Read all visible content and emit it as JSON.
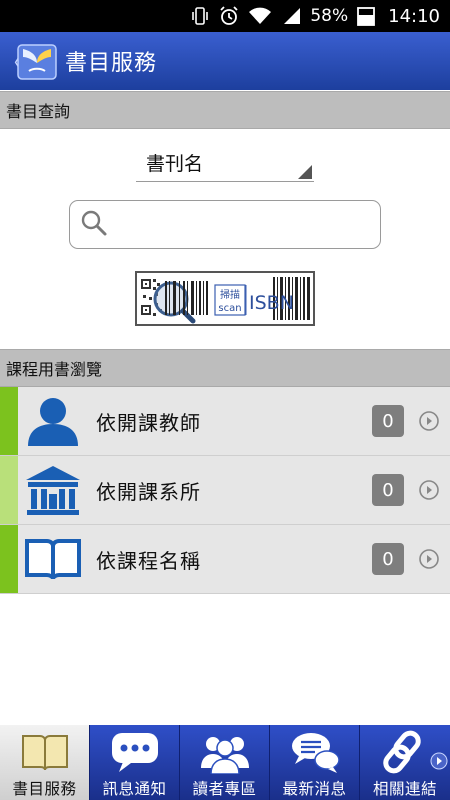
{
  "status_bar": {
    "battery_percent": "58%",
    "time": "14:10",
    "icons": [
      "vibrate-icon",
      "alarm-icon",
      "wifi-icon",
      "signal-icon",
      "battery-icon"
    ]
  },
  "header": {
    "back_glyph": "〈",
    "title": "書目服務"
  },
  "search_section": {
    "title": "書目查詢",
    "field_selected": "書刊名",
    "search_value": "",
    "isbn_button": {
      "label_top": "掃描",
      "label_bottom": "scan",
      "label_isbn": "ISBN"
    }
  },
  "browse_section": {
    "title": "課程用書瀏覽",
    "items": [
      {
        "label": "依開課教師",
        "count": "0",
        "icon": "teacher-icon",
        "accent": "#7cc21e"
      },
      {
        "label": "依開課系所",
        "count": "0",
        "icon": "department-building-icon",
        "accent": "#b9e07a"
      },
      {
        "label": "依課程名稱",
        "count": "0",
        "icon": "open-book-icon",
        "accent": "#7cc21e"
      }
    ]
  },
  "bottom_nav": {
    "items": [
      {
        "label": "書目服務",
        "icon": "book-icon",
        "active": true
      },
      {
        "label": "訊息通知",
        "icon": "speech-bubble-icon",
        "active": false
      },
      {
        "label": "讀者專區",
        "icon": "users-group-icon",
        "active": false
      },
      {
        "label": "最新消息",
        "icon": "chat-bubbles-icon",
        "active": false
      },
      {
        "label": "相關連結",
        "icon": "link-chain-icon",
        "active": false
      }
    ]
  },
  "colors": {
    "header_blue": "#2a4fbf",
    "accent_green": "#7cc21e",
    "section_gray": "#bdbdbd",
    "list_gray": "#e6e6e6"
  }
}
